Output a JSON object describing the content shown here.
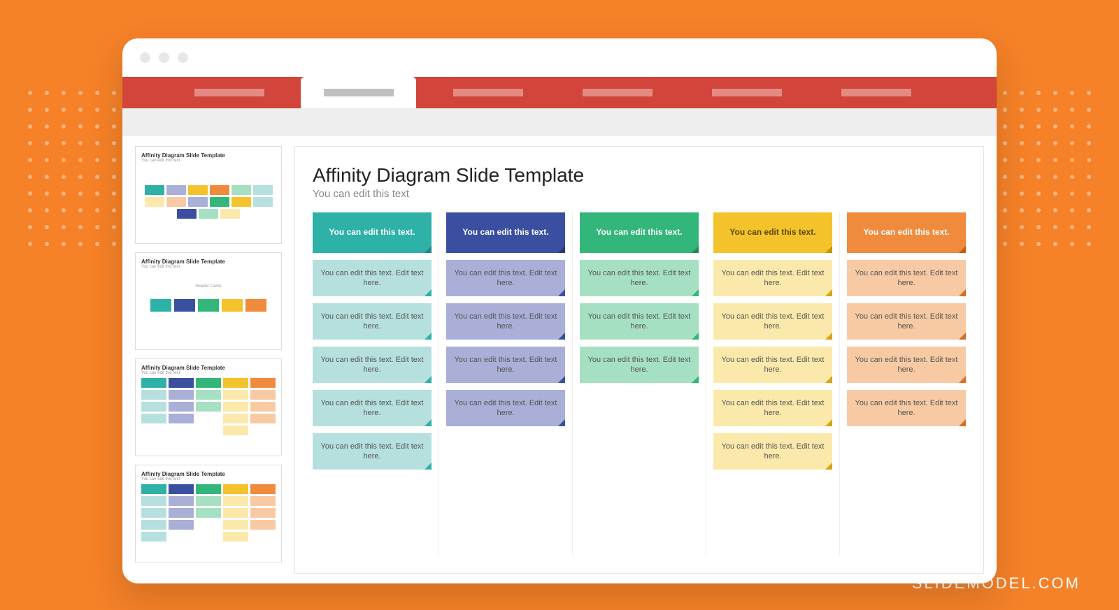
{
  "watermark": "SLIDEMODEL.COM",
  "slide": {
    "title": "Affinity Diagram Slide Template",
    "subtitle": "You can edit this text",
    "header_text": "You can edit this text.",
    "note_text": "You can edit this text. Edit text here.",
    "columns": [
      {
        "key": "c1",
        "notes": 5
      },
      {
        "key": "c2",
        "notes": 4
      },
      {
        "key": "c3",
        "notes": 3
      },
      {
        "key": "c4",
        "notes": 5
      },
      {
        "key": "c5",
        "notes": 4
      }
    ]
  },
  "thumbnails": [
    {
      "title": "Affinity Diagram Slide Template",
      "sub": "You can edit this text"
    },
    {
      "title": "Affinity Diagram Slide Template",
      "sub": "You can edit this text",
      "label": "Header Cards"
    },
    {
      "title": "Affinity Diagram Slide Template",
      "sub": "You can edit this text"
    },
    {
      "title": "Affinity Diagram Slide Template",
      "sub": "You can edit this text"
    }
  ],
  "colors": {
    "teal": "#2eb1a6",
    "blue": "#3b4fa0",
    "green": "#33b679",
    "yellow": "#f4c22b",
    "orange": "#f08a3c"
  }
}
